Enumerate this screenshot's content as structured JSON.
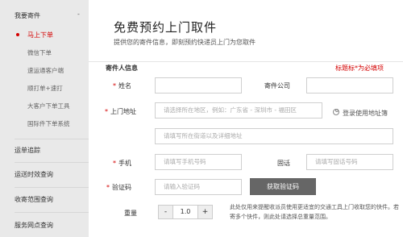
{
  "sidebar": {
    "header": "我要寄件",
    "header_arrow": "-",
    "items": [
      {
        "label": "马上下单"
      },
      {
        "label": "微信下单"
      },
      {
        "label": "速运通客户端"
      },
      {
        "label": "顺打单+速打"
      },
      {
        "label": "大客户下单工具"
      },
      {
        "label": "国际件下单系统"
      }
    ],
    "sections": [
      {
        "label": "运单追踪"
      },
      {
        "label": "运送时效查询"
      },
      {
        "label": "收寄范围查询"
      },
      {
        "label": "服务网点查询"
      }
    ]
  },
  "main": {
    "title": "免费预约上门取件",
    "subtitle": "提供您的寄件信息，即刻预约快递员上门为您取件",
    "section_label": "寄件人信息",
    "note": "标题标*为必填项",
    "form": {
      "name_label": "姓名",
      "company_label": "寄件公司",
      "address_label": "上门地址",
      "area_placeholder": "请选择所在地区，例如：广东省 - 深圳市 - 福田区",
      "address_book": "登录使用地址簿",
      "street_placeholder": "请填写所在街道以及详细地址",
      "mobile_label": "手机",
      "mobile_placeholder": "请填写手机号码",
      "phone_label": "固话",
      "phone_placeholder": "请填写固话号码",
      "code_label": "验证码",
      "code_placeholder": "请输入验证码",
      "code_button": "获取验证码",
      "weight_label": "重量",
      "weight_value": "1.0",
      "minus": "-",
      "plus": "+",
      "hint": "此处仅用来提醒收派员使用更适宜的交通工具上门收取您的快件。若寄多个快件，则此处请选择总重量范围。"
    }
  },
  "colors": {
    "accent_red": "#d40000",
    "button_gray": "#666666",
    "sidebar_bg": "#e9e9e9"
  }
}
